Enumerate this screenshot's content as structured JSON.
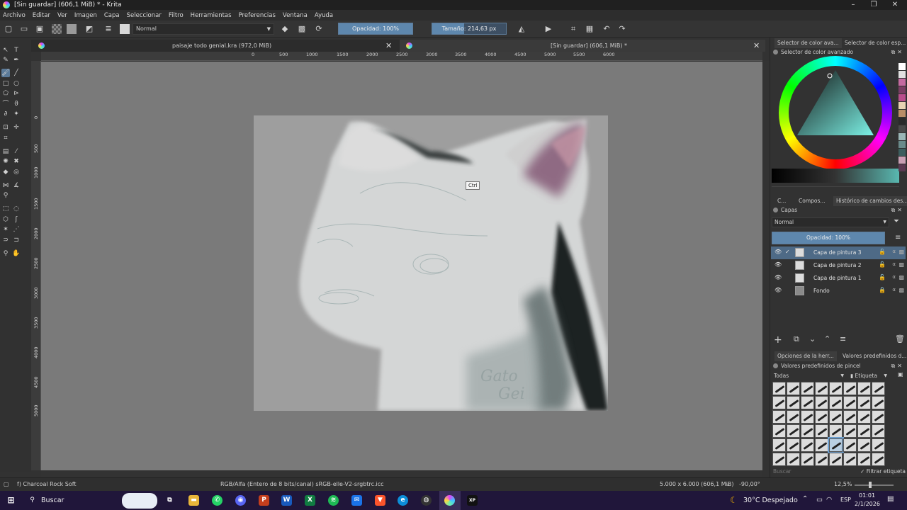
{
  "window": {
    "title": "[Sin guardar]  (606,1 MiB) * - Krita"
  },
  "menu": [
    "Archivo",
    "Editar",
    "Ver",
    "Imagen",
    "Capa",
    "Seleccionar",
    "Filtro",
    "Herramientas",
    "Preferencias",
    "Ventana",
    "Ayuda"
  ],
  "toolbar": {
    "blend_mode": "Normal",
    "opacity": "Opacidad: 100%",
    "size": "Tamaño: 214,63 px",
    "opacity_fraction": 1.0,
    "size_fraction": 0.43
  },
  "doc_tabs": [
    {
      "label": "paisaje todo genial.kra (972,0 MiB)"
    },
    {
      "label": "[Sin guardar]  (606,1 MiB) *"
    }
  ],
  "ruler": {
    "top": [
      "0",
      "500",
      "1000",
      "1500",
      "2000",
      "2500",
      "3000",
      "3500",
      "4000",
      "4500",
      "5000",
      "5500",
      "6000"
    ],
    "left": [
      "0",
      "500",
      "1000",
      "1500",
      "2000",
      "2500",
      "3000",
      "3500",
      "4000",
      "4500",
      "5000"
    ]
  },
  "canvas": {
    "tooltip": "Ctrl",
    "signature": "Gato\nGei",
    "background": "#7a7a7a"
  },
  "dock": {
    "color_tabs": [
      "Selector de color ava...",
      "Selector de color esp..."
    ],
    "color_panel_title": "Selector de color avanzado",
    "mid_tabs": [
      "C...",
      "Compos...",
      "Histórico de cambios des..."
    ],
    "layers": {
      "title": "Capas",
      "blend_mode": "Normal",
      "opacity": "Opacidad:  100%",
      "items": [
        {
          "name": "Capa de pintura 3",
          "selected": true
        },
        {
          "name": "Capa de pintura 2",
          "selected": false
        },
        {
          "name": "Capa de pintura 1",
          "selected": false
        },
        {
          "name": "Fondo",
          "selected": false
        }
      ]
    },
    "brush_tabs": [
      "Opciones de la herr...",
      "Valores predefinidos d..."
    ],
    "brush_panel_title": "Valores predefinidos de pincel",
    "brush_filter": "Todas",
    "brush_tag": "Etiqueta",
    "brush_search_placeholder": "Buscar",
    "brush_filter_tag": "Filtrar etiqueta",
    "swatches": [
      "#ffffff",
      "#e0e0e0",
      "#c46aa0",
      "#7a3d63",
      "#b84d8c",
      "#e8d3b3",
      "#b88d67",
      "#2a2a2a",
      "#4a4a4a",
      "#9ab6b6",
      "#6a8a8a",
      "#3c5e5e",
      "#c9a0b4",
      "#5b3a52"
    ]
  },
  "status": {
    "brush": "f) Charcoal Rock Soft",
    "color_space": "RGB/Alfa (Entero de 8 bits/canal)  sRGB-elle-V2-srgbtrc.icc",
    "dimensions": "5.000 x 6.000 (606,1 MiB)",
    "rotation": "-90,00°",
    "zoom": "12,5%"
  },
  "taskbar": {
    "search": "Buscar",
    "weather": "30°C  Despejado",
    "lang": "ESP",
    "time": "01:01",
    "date": "2/1/2026"
  }
}
